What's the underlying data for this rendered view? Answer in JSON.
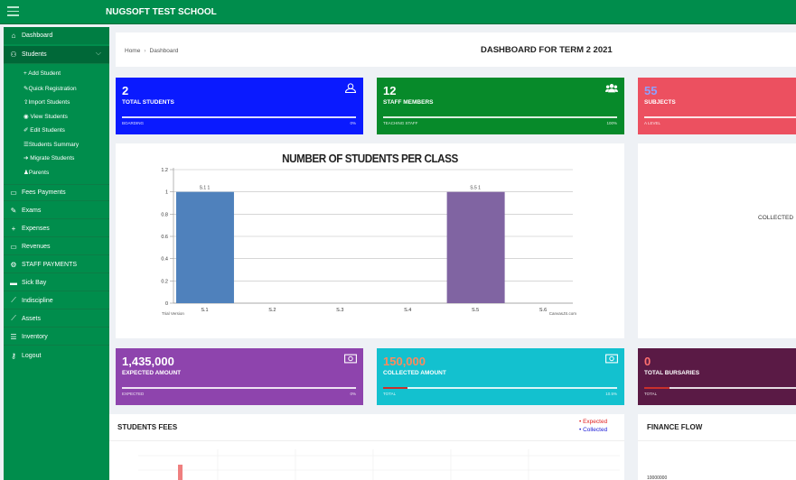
{
  "app": {
    "school_name": "NUGSOFT TEST SCHOOL"
  },
  "sidebar": {
    "dashboard": "Dashboard",
    "students": "Students",
    "student_sub": [
      "+ Add Student",
      "Quick Registration",
      "Import Students",
      "View Students",
      "Edit Students",
      "Students Summary",
      "Migrate Students",
      "Parents"
    ],
    "items": [
      "Fees Payments",
      "Exams",
      "Expenses",
      "Revenues",
      "STAFF PAYMENTS",
      "Sick Bay",
      "Indiscipline",
      "Assets",
      "Inventory",
      "Logout"
    ]
  },
  "breadcrumb": {
    "home": "Home",
    "current": "Dashboard"
  },
  "page_title": "DASHBOARD FOR TERM 2 2021",
  "cards_top": [
    {
      "value": "2",
      "label": "TOTAL STUDENTS",
      "footer": "BOARDING",
      "pct": "0%",
      "color": "#0a1aff"
    },
    {
      "value": "12",
      "label": "STAFF MEMBERS",
      "footer": "TEACHING STAFF",
      "pct": "100%",
      "color": "#078a2a"
    },
    {
      "value": "55",
      "label": "SUBJECTS",
      "footer": "A LEVEL",
      "color": "#ec5060"
    }
  ],
  "cards_bottom": [
    {
      "value": "1,435,000",
      "label": "EXPECTED AMOUNT",
      "footer": "EXPECTED",
      "pct": "0%",
      "color": "#8e44ad"
    },
    {
      "value": "150,000",
      "label": "COLLECTED AMOUNT",
      "footer": "TOTAL",
      "pct": "10.5%",
      "progress": 0.105,
      "color": "#13c1cf"
    },
    {
      "value": "0",
      "label": "TOTAL BURSARIES",
      "footer": "TOTAL",
      "color": "#5a1a45"
    }
  ],
  "side_panel_label": "COLLECTED",
  "students_fees": {
    "title": "STUDENTS FEES",
    "legend_expected": "Expected",
    "legend_collected": "Collected",
    "expected_color": "#e02020",
    "collected_color": "#1a1ad6"
  },
  "finance_flow": {
    "title": "FINANCE FLOW",
    "axis_top": "10000000"
  },
  "chart_footer": {
    "left": "Trial Version",
    "right": "CanvasJS.com"
  },
  "chart_data": {
    "type": "bar",
    "title": "NUMBER OF STUDENTS PER CLASS",
    "categories": [
      "S.1",
      "S.2",
      "S.3",
      "S.4",
      "S.5",
      "S.6"
    ],
    "values": [
      1,
      0,
      0,
      0,
      1,
      0
    ],
    "data_labels": [
      "S.1 1",
      "",
      "",
      "",
      "S.5 1",
      ""
    ],
    "bar_colors": [
      "#4f81bc",
      "#4f81bc",
      "#4f81bc",
      "#4f81bc",
      "#8064a2",
      "#4f81bc"
    ],
    "yticks": [
      "0",
      "0.2",
      "0.4",
      "0.6",
      "0.8",
      "1",
      "1.2"
    ],
    "ylim": [
      0,
      1.2
    ],
    "grid": true
  }
}
